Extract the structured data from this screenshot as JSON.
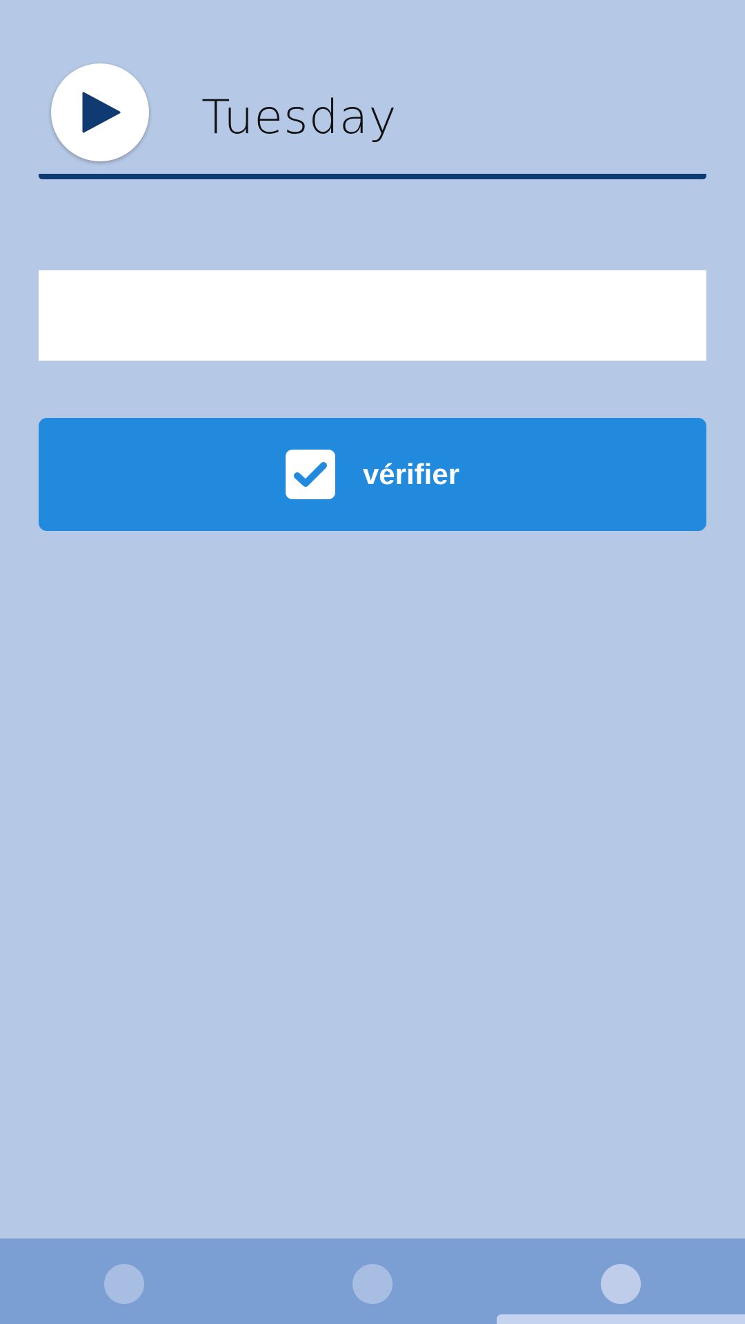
{
  "exercise": {
    "word": "Tuesday",
    "play_icon": "play-icon",
    "answer": {
      "value": "",
      "placeholder": ""
    },
    "verify": {
      "label": "vérifier",
      "icon": "checkbox-check-icon"
    }
  },
  "pagination": {
    "total": 3,
    "current": 3
  },
  "colors": {
    "background": "#b5c8e5",
    "accent": "#228adc",
    "dark_blue": "#0f3a72",
    "bottom_bar": "#7b9fd3"
  }
}
